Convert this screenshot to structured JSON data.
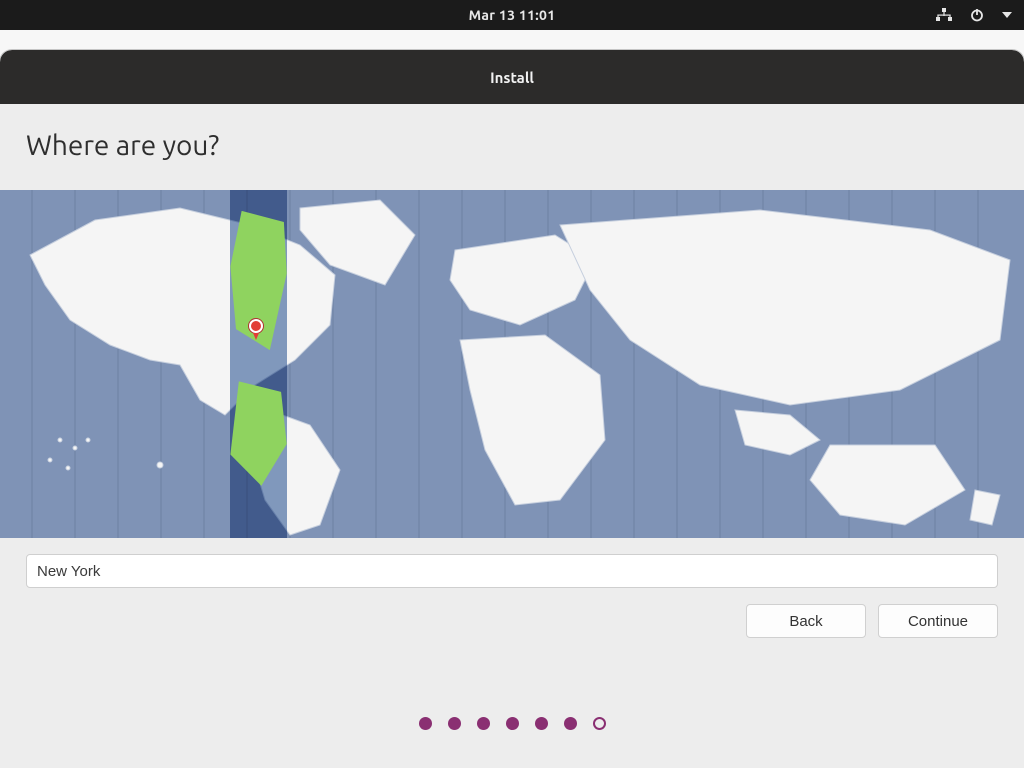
{
  "topbar": {
    "clock": "Mar 13  11:01"
  },
  "window": {
    "title": "Install"
  },
  "page": {
    "heading": "Where are you?",
    "location_value": "New York"
  },
  "buttons": {
    "back": "Back",
    "continue": "Continue"
  },
  "map": {
    "selected_timezone": "America/New_York",
    "highlight_band": {
      "left_pct": 22.5,
      "width_pct": 5.5
    },
    "pin": {
      "x_pct": 25.0,
      "y_pct": 39.0
    }
  },
  "progress": {
    "total": 7,
    "current_index": 6
  },
  "colors": {
    "accent": "#8a2f72",
    "ocean": "#7f93b6",
    "land": "#f5f5f5",
    "tz_green": "#8fd35f",
    "pin": "#e23d36"
  }
}
